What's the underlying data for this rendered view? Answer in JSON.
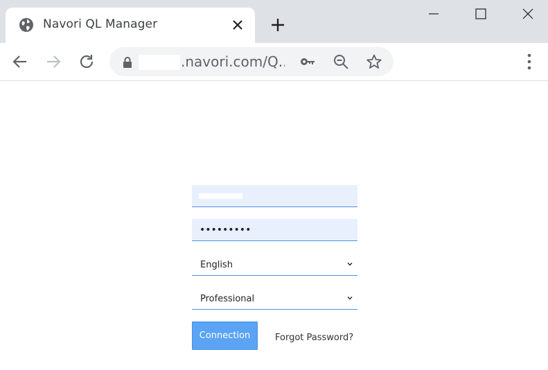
{
  "browser": {
    "tab": {
      "title": "Navori QL Manager",
      "icon": "globe-icon"
    },
    "address_bar": {
      "url_visible": ".navori.com/Q..."
    },
    "colors": {
      "tabstrip": "#dee1e6",
      "omnibox": "#f1f3f4"
    }
  },
  "login": {
    "username": {
      "value": ""
    },
    "password": {
      "value": "•••••••••"
    },
    "language": {
      "selected": "English"
    },
    "edition": {
      "selected": "Professional"
    },
    "connect_label": "Connection",
    "forgot_label": "Forgot Password?",
    "colors": {
      "field_bg": "#e8f0fe",
      "accent": "#4a90e2",
      "button": "#5aa3f5"
    }
  }
}
